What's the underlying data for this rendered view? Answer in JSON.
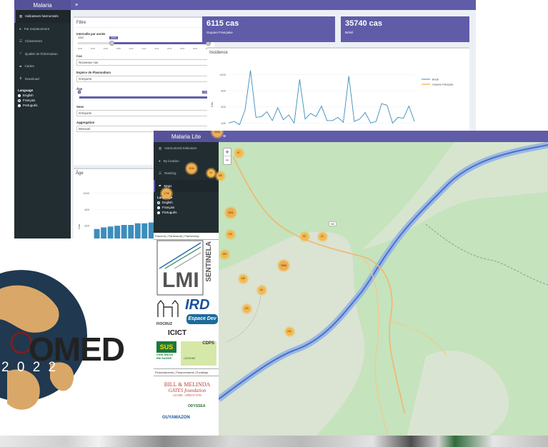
{
  "app1": {
    "title": "Malaria",
    "menu": "≡",
    "sidebar": [
      {
        "icon": "bar-chart-icon",
        "label": "Indicateurs harmonisés"
      },
      {
        "icon": "pin-icon",
        "label": "Par emplacement"
      },
      {
        "icon": "list-icon",
        "label": "Classement"
      },
      {
        "icon": "check-icon",
        "label": "Qualité de l'information"
      },
      {
        "icon": "map-icon",
        "label": "Cartes"
      },
      {
        "icon": "download-icon",
        "label": "Download"
      }
    ],
    "language": {
      "label": "Language",
      "options": [
        "English",
        "Français",
        "Português"
      ],
      "selected": "Français"
    },
    "filter": {
      "title": "Filtre",
      "interval_label": "Intervalle par année",
      "year_min": "2003",
      "year_from": "2009",
      "year_to": "2022",
      "ticks": [
        "2003",
        "2004",
        "2006",
        "2008",
        "2010",
        "2012",
        "2014",
        "2016",
        "2018",
        "2020",
        "2022"
      ],
      "cas_label": "Cas",
      "cas_value": "Nouveaux cas",
      "espece_label": "Espèce de Plasmodium",
      "espece_value": "N'importe",
      "age_label": "Âge",
      "age_from": "0",
      "age_to": "100",
      "sexe_label": "Sexe",
      "sexe_value": "N'importe",
      "aggreg_label": "Aggregation",
      "aggreg_value": "Mensuel"
    },
    "kpi1": {
      "value": "6115 cas",
      "label": "Guyane Française"
    },
    "kpi2": {
      "value": "35740 cas",
      "label": "Brésil"
    },
    "incidence": {
      "title": "Incidence",
      "ylabel": "Cas",
      "yticks": [
        "1000",
        "800",
        "600",
        "400"
      ]
    },
    "age_box": {
      "title": "Âge",
      "ylabel": "Cas",
      "yticks": [
        "1000",
        "800",
        "600"
      ]
    }
  },
  "chart_data": [
    {
      "type": "line",
      "title": "Incidence",
      "ylabel": "Cas",
      "ylim": [
        350,
        1100
      ],
      "series": [
        {
          "name": "Brésil",
          "color": "#3c8dbc",
          "values": [
            400,
            420,
            380,
            560,
            1050,
            470,
            480,
            540,
            430,
            590,
            440,
            500,
            400,
            940,
            450,
            520,
            480,
            610,
            430,
            430,
            470,
            410,
            980,
            420,
            450,
            530,
            400,
            420,
            640,
            620,
            400,
            470,
            460,
            610,
            420
          ]
        },
        {
          "name": "Guyane Française",
          "color": "#f39c12",
          "values": []
        }
      ]
    },
    {
      "type": "bar",
      "title": "Âge",
      "ylabel": "Cas",
      "ylim": [
        400,
        1100
      ],
      "values": [
        560,
        580,
        590,
        600,
        610,
        610,
        630,
        630,
        640,
        620,
        650,
        690,
        740,
        730,
        700,
        730,
        710
      ]
    }
  ],
  "app2": {
    "title": "Malaria Lite",
    "menu": "≡",
    "sidebar": [
      {
        "icon": "bar-chart-icon",
        "label": "Harmonized Indicators"
      },
      {
        "icon": "pin-icon",
        "label": "By location"
      },
      {
        "icon": "list-icon",
        "label": "Ranking"
      },
      {
        "icon": "map-icon",
        "label": "Maps"
      }
    ],
    "language": {
      "label": "Language",
      "options": [
        "English",
        "Français",
        "Português"
      ],
      "selected": "English"
    },
    "partners_title": "Parcería | Partenariat | Partnership",
    "funding_title": "Financiamento | Financements | Fundings",
    "logos": {
      "lmi": "LMI",
      "sentinela": "SENTINELA",
      "fiocruz": "FIOCRUZ",
      "ird": "IRD",
      "espace": "Espace Dev",
      "icict": "ICICT",
      "sus": "SUS",
      "vigilancia": "VIGILÂNCIA EM SAÚDE",
      "cdps": "CDPS",
      "cayenne": "CAYENNE",
      "gates1": "BILL & MELINDA",
      "gates2": "GATES foundation",
      "gates3": "GCGH8 - OPP01573795",
      "odyssea": "ODYSSEA",
      "guyamazon": "GUYAMAZON"
    },
    "map": {
      "zoom_in": "+",
      "zoom_out": "−",
      "road": "N2",
      "clusters": [
        {
          "v": "312"
        },
        {
          "v": "474"
        },
        {
          "v": "330"
        },
        {
          "v": "185"
        },
        {
          "v": "82"
        },
        {
          "v": "15081"
        },
        {
          "v": "67"
        },
        {
          "v": "1198"
        },
        {
          "v": "12"
        },
        {
          "v": "155"
        },
        {
          "v": "1798"
        },
        {
          "v": "3001"
        },
        {
          "v": "176"
        },
        {
          "v": "190"
        },
        {
          "v": "92"
        },
        {
          "v": "41"
        },
        {
          "v": "9988"
        },
        {
          "v": "145"
        },
        {
          "v": "64"
        },
        {
          "v": "170"
        },
        {
          "v": "241"
        }
      ]
    }
  },
  "medal": {
    "text": "OMED",
    "year": "2 0 2 2"
  }
}
